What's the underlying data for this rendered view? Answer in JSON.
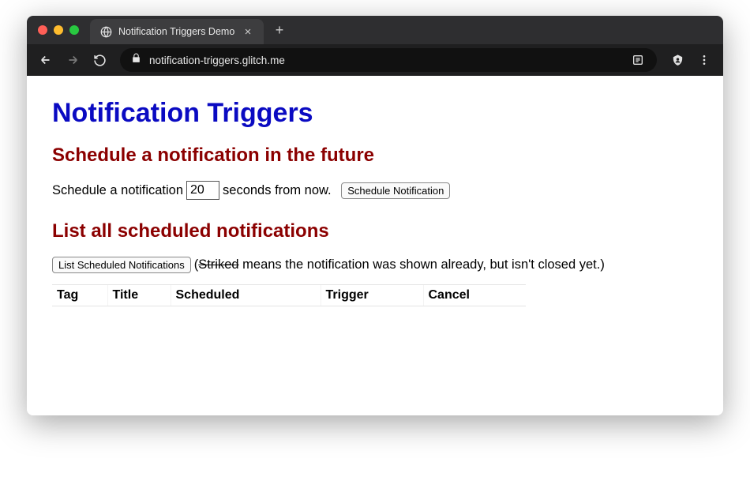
{
  "browser": {
    "tab_title": "Notification Triggers Demo",
    "url": "notification-triggers.glitch.me"
  },
  "page": {
    "h1": "Notification Triggers",
    "section1": {
      "heading": "Schedule a notification in the future",
      "text_before": "Schedule a notification",
      "seconds_value": "20",
      "text_after": "seconds from now.",
      "button_label": "Schedule Notification"
    },
    "section2": {
      "heading": "List all scheduled notifications",
      "button_label": "List Scheduled Notifications",
      "hint_open_paren": "(",
      "hint_striked": "Striked",
      "hint_rest": " means the notification was shown already, but isn't closed yet.)",
      "columns": {
        "tag": "Tag",
        "title": "Title",
        "scheduled": "Scheduled",
        "trigger": "Trigger",
        "cancel": "Cancel"
      }
    }
  }
}
